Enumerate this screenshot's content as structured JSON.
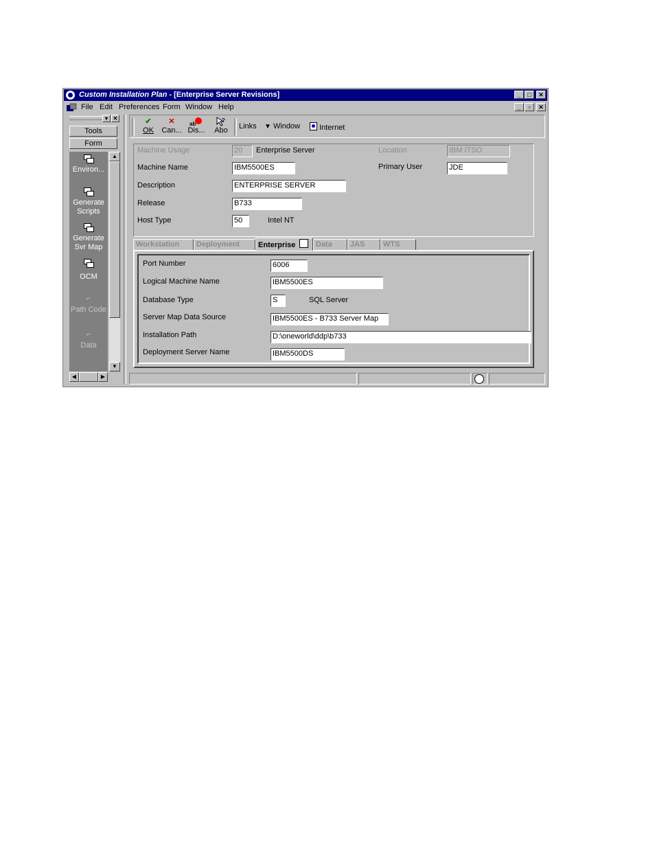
{
  "window": {
    "title_italic": "Custom Installation Plan",
    "title_rest": " - [Enterprise Server Revisions]"
  },
  "menu": {
    "items": [
      "File",
      "Edit",
      "Preferences",
      "Form",
      "Window",
      "Help"
    ]
  },
  "left": {
    "tools_label": "Tools",
    "form_label": "Form",
    "items": [
      {
        "label": "Environ..."
      },
      {
        "label": "Generate Scripts"
      },
      {
        "label": "Generate Svr Map"
      },
      {
        "label": "OCM"
      },
      {
        "label": "Path Code"
      },
      {
        "label": "Data"
      }
    ]
  },
  "toolbar": {
    "ok_label": "OK",
    "cancel_label": "Can...",
    "display_label": "Dis...",
    "about_label": "Abo",
    "links_label": "Links",
    "window_label": "Window",
    "internet_label": "Internet"
  },
  "header": {
    "machine_usage_label": "Machine Usage",
    "machine_usage_value": "20",
    "machine_usage_desc": "Enterprise Server",
    "location_label": "Location",
    "location_value": "IBM ITSO",
    "machine_name_label": "Machine Name",
    "machine_name_value": "IBM5500ES",
    "primary_user_label": "Primary User",
    "primary_user_value": "JDE",
    "description_label": "Description",
    "description_value": "ENTERPRISE SERVER",
    "release_label": "Release",
    "release_value": "B733",
    "host_type_label": "Host Type",
    "host_type_value": "50",
    "host_type_desc": "Intel NT"
  },
  "tabs": [
    "Workstation",
    "Deployment",
    "Enterprise",
    "Data",
    "JAS",
    "WTS"
  ],
  "enterprise": {
    "port_label": "Port Number",
    "port_value": "6006",
    "logical_label": "Logical Machine Name",
    "logical_value": "IBM5500ES",
    "dbtype_label": "Database Type",
    "dbtype_value": "S",
    "dbtype_desc": "SQL Server",
    "datasource_label": "Server Map Data Source",
    "datasource_value": "IBM5500ES - B733 Server Map",
    "path_label": "Installation Path",
    "path_value": "D:\\oneworld\\ddp\\b733",
    "deploy_label": "Deployment Server Name",
    "deploy_value": "IBM5500DS"
  }
}
